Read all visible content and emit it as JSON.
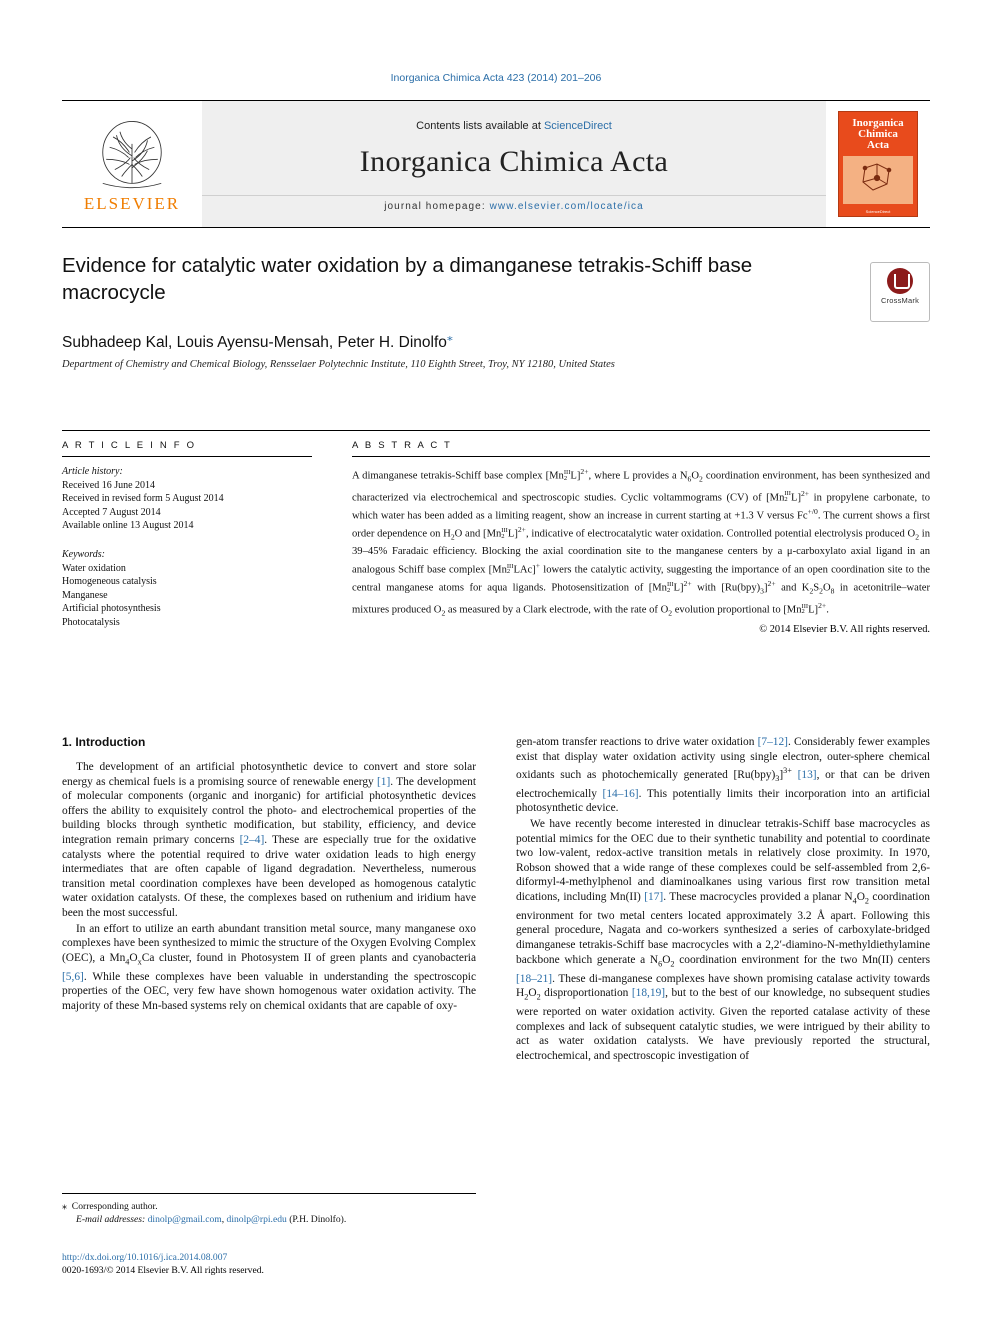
{
  "journal_ref": "Inorganica Chimica Acta 423 (2014) 201–206",
  "masthead": {
    "contents_prefix": "Contents lists available at ",
    "contents_link": "ScienceDirect",
    "journal_title": "Inorganica Chimica Acta",
    "homepage_prefix": "journal homepage: ",
    "homepage_link": "www.elsevier.com/locate/ica",
    "publisher": "ELSEVIER",
    "cover_title_line1": "Inorganica",
    "cover_title_line2": "Chimica",
    "cover_title_line3": "Acta"
  },
  "article": {
    "title": "Evidence for catalytic water oxidation by a dimanganese tetrakis-Schiff base macrocycle",
    "crossmark_label": "CrossMark",
    "authors": "Subhadeep Kal, Louis Ayensu-Mensah, Peter H. Dinolfo",
    "affiliation": "Department of Chemistry and Chemical Biology, Rensselaer Polytechnic Institute, 110 Eighth Street, Troy, NY 12180, United States"
  },
  "info": {
    "heading": "A R T I C L E   I N F O",
    "history_label": "Article history:",
    "history": [
      "Received 16 June 2014",
      "Received in revised form 5 August 2014",
      "Accepted 7 August 2014",
      "Available online 13 August 2014"
    ],
    "keywords_label": "Keywords:",
    "keywords": [
      "Water oxidation",
      "Homogeneous catalysis",
      "Manganese",
      "Artificial photosynthesis",
      "Photocatalysis"
    ]
  },
  "abstract": {
    "heading": "A B S T R A C T",
    "copyright": "© 2014 Elsevier B.V. All rights reserved."
  },
  "sections": {
    "intro_heading": "1. Introduction"
  },
  "footnotes": {
    "corresponding": "Corresponding author.",
    "email_label": "E-mail addresses:",
    "email1": "dinolp@gmail.com",
    "email2": "dinolp@rpi.edu",
    "email_suffix": "(P.H. Dinolfo)."
  },
  "doi": {
    "url": "http://dx.doi.org/10.1016/j.ica.2014.08.007",
    "issn_line": "0020-1693/© 2014 Elsevier B.V. All rights reserved."
  },
  "colors": {
    "link": "#2b6ea8",
    "elsevier_orange": "#f07d00",
    "cover_red": "#e84b1c"
  }
}
